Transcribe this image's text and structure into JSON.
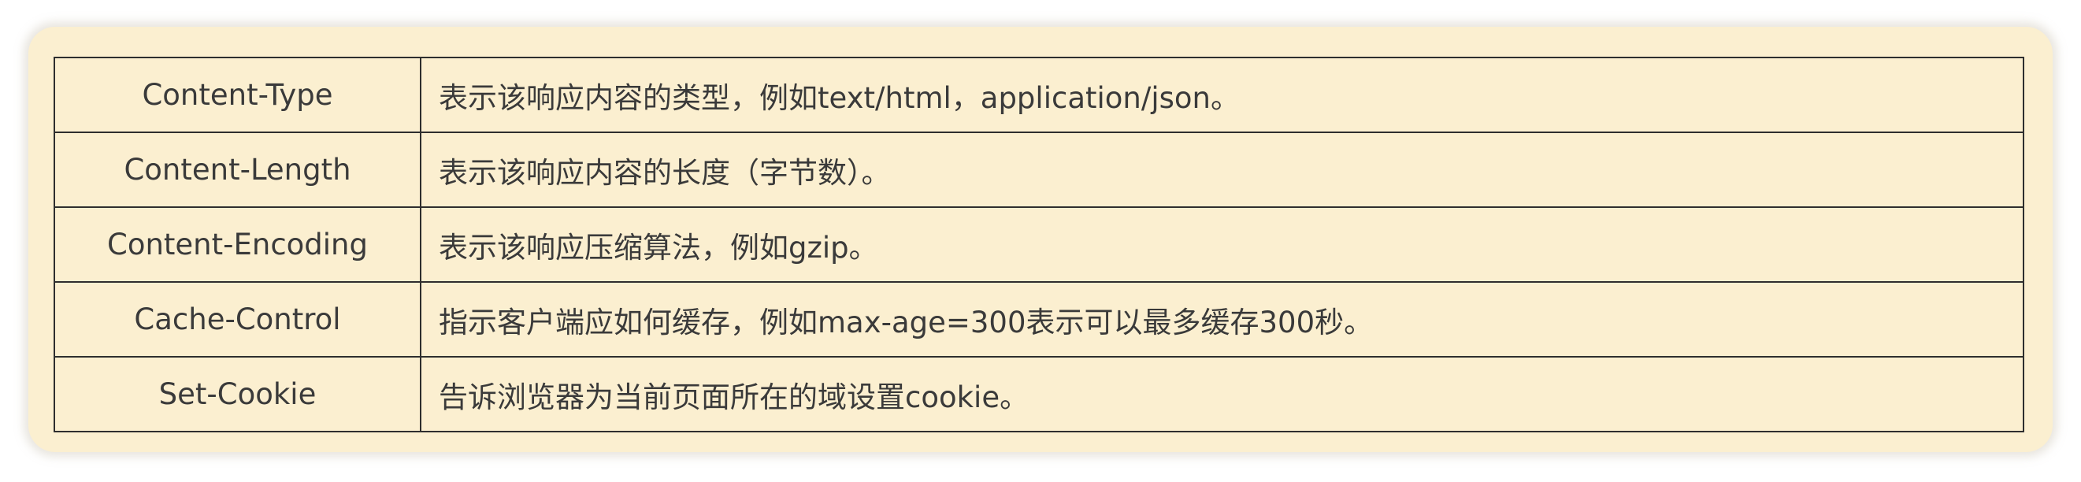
{
  "table": {
    "rows": [
      {
        "key": "Content-Type",
        "description": "表示该响应内容的类型，例如text/html，application/json。"
      },
      {
        "key": "Content-Length",
        "description": "表示该响应内容的长度（字节数）。"
      },
      {
        "key": "Content-Encoding",
        "description": "表示该响应压缩算法，例如gzip。"
      },
      {
        "key": "Cache-Control",
        "description": "指示客户端应如何缓存，例如max-age=300表示可以最多缓存300秒。"
      },
      {
        "key": "Set-Cookie",
        "description": "告诉浏览器为当前页面所在的域设置cookie。"
      }
    ]
  },
  "colors": {
    "background": "#fbefd0",
    "border": "#2e2e2e",
    "text": "#3a3a3a"
  }
}
